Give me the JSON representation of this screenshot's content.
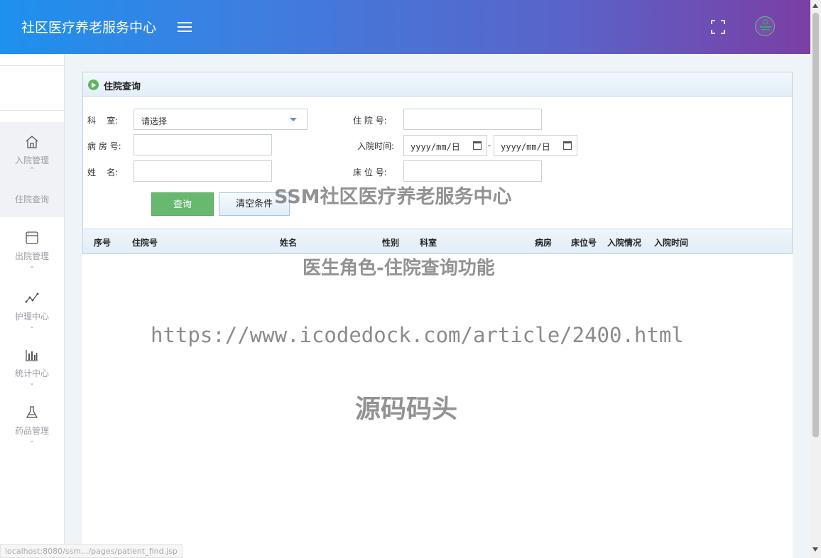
{
  "header": {
    "brand": "社区医疗养老服务中心",
    "menu_icon": "hamburger-icon",
    "fullscreen_icon": "fullscreen-icon",
    "avatar_icon": "avatar"
  },
  "sidebar": {
    "items": [
      {
        "label": "入院管理",
        "icon": "home-icon",
        "expanded": true
      },
      {
        "label": "出院管理",
        "icon": "browser-window-icon",
        "expanded": false
      },
      {
        "label": "护理中心",
        "icon": "line-chart-icon",
        "expanded": false
      },
      {
        "label": "统计中心",
        "icon": "bar-chart-icon",
        "expanded": false
      },
      {
        "label": "药品管理",
        "icon": "flask-icon",
        "expanded": false
      }
    ],
    "sub_item": "住院查询",
    "chevron_up": "^",
    "chevron_down": "⌄"
  },
  "panel": {
    "title": "住院查询"
  },
  "form": {
    "dept_label": "科    室:",
    "dept_value": "请选择",
    "admission_no_label": "住 院 号:",
    "admission_no_value": "",
    "ward_label": "病 房 号:",
    "ward_value": "",
    "admit_time_label": "入院时间:",
    "date_from": "yyyy/mm/日",
    "date_sep": "-",
    "date_to": "yyyy/mm/日",
    "name_label": "姓    名:",
    "name_value": "",
    "bed_label": "床 位 号:",
    "bed_value": "",
    "query_button": "查询",
    "clear_button": "清空条件"
  },
  "table": {
    "columns": [
      "序号",
      "住院号",
      "姓名",
      "性别",
      "科室",
      "病房",
      "床位号",
      "入院情况",
      "入院时间"
    ],
    "rows": []
  },
  "watermarks": {
    "line1": "SSM社区医疗养老服务中心",
    "line2": "医生角色-住院查询功能",
    "line3": "https://www.icodedock.com/article/2400.html",
    "line4": "源码码头"
  },
  "status_bar": {
    "url": "localhost:8080/ssm.../pages/patient_find.jsp"
  },
  "colors": {
    "header_gradient_start": "#1e90ef",
    "header_gradient_end": "#7a3fa4",
    "query_button": "#69b86f",
    "panel_border": "#bfd5e8"
  }
}
